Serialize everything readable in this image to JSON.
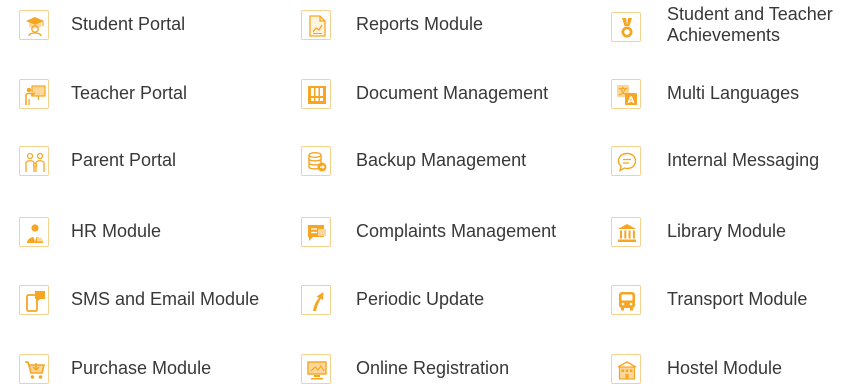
{
  "accent_color": "#f6a623",
  "border_color": "#f6d28f",
  "text_color": "#383838",
  "columns": [
    {
      "items": [
        {
          "label": "Student Portal",
          "icon": "student-icon"
        },
        {
          "label": "Teacher Portal",
          "icon": "teacher-board-icon"
        },
        {
          "label": "Parent Portal",
          "icon": "family-icon"
        },
        {
          "label": "HR Module",
          "icon": "person-tie-icon"
        },
        {
          "label": "SMS and Email Module",
          "icon": "phone-chat-icon"
        },
        {
          "label": "Purchase Module",
          "icon": "shopping-cart-icon"
        }
      ]
    },
    {
      "items": [
        {
          "label": "Reports Module",
          "icon": "chart-document-icon"
        },
        {
          "label": "Document Management",
          "icon": "document-grid-icon"
        },
        {
          "label": "Backup Management",
          "icon": "database-backup-icon"
        },
        {
          "label": "Complaints Management",
          "icon": "speech-bubble-icon"
        },
        {
          "label": "Periodic Update",
          "icon": "arrow-up-icon"
        },
        {
          "label": "Online Registration",
          "icon": "computer-monitor-icon"
        }
      ]
    },
    {
      "items": [
        {
          "label": "Student and Teacher Achievements",
          "icon": "medal-icon"
        },
        {
          "label": "Multi Languages",
          "icon": "translate-icon"
        },
        {
          "label": "Internal Messaging",
          "icon": "chat-bubble-icon"
        },
        {
          "label": "Library Module",
          "icon": "library-building-icon"
        },
        {
          "label": "Transport Module",
          "icon": "bus-icon"
        },
        {
          "label": "Hostel Module",
          "icon": "building-icon"
        }
      ]
    }
  ]
}
